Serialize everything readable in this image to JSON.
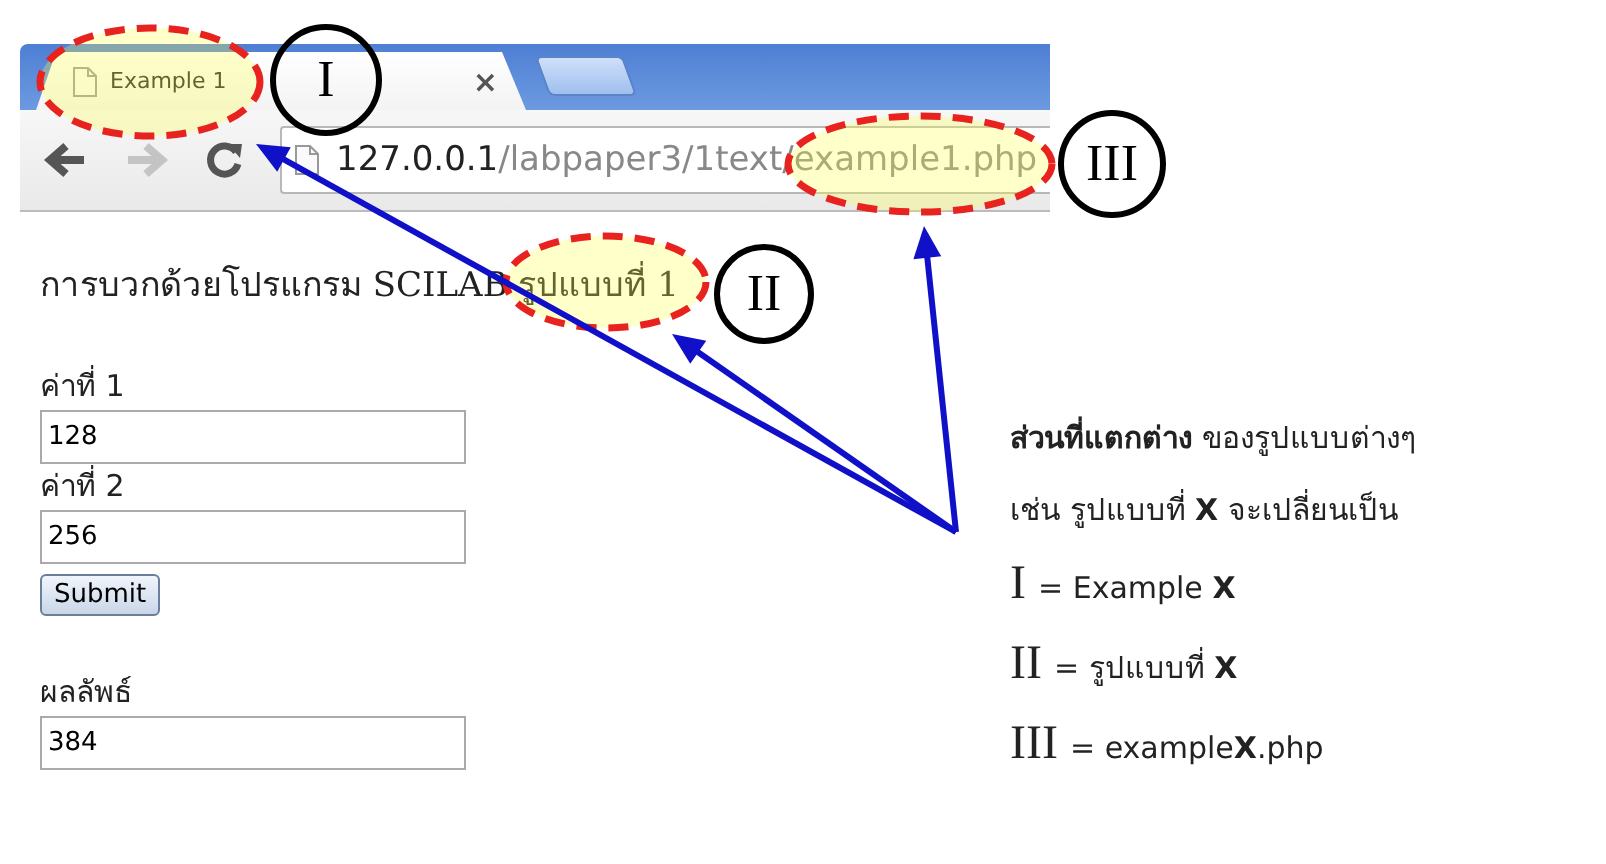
{
  "browser": {
    "tabs": [
      {
        "title": "Example 1",
        "close": "×",
        "selected": true
      }
    ],
    "nav": [
      {
        "kind": "back",
        "disabled": false
      },
      {
        "kind": "forward",
        "disabled": true
      },
      {
        "kind": "reload",
        "disabled": false
      }
    ],
    "address": {
      "host": "127.0.0.1",
      "path": "/labpaper3/1text/example1.php"
    }
  },
  "page": {
    "heading": "การบวกด้วยโปรแกรม SCILAB รูปแบบที่ 1",
    "fields": [
      {
        "label": "ค่าที่ 1",
        "value": "128"
      },
      {
        "label": "ค่าที่ 2",
        "value": "256"
      }
    ],
    "submit": "Submit",
    "result": {
      "label": "ผลลัพธ์",
      "value": "384"
    }
  },
  "annotations": [
    {
      "label": "I"
    },
    {
      "label": "II"
    },
    {
      "label": "III"
    }
  ],
  "legend": {
    "lines": [
      "**ส่วนที่แตกต่าง** ของรูปแบบต่างๆ",
      "เช่น รูปแบบที่ **X** จะเปลี่ยนเป็น"
    ],
    "items": [
      {
        "numeral": "I",
        "text": "= Example **X**"
      },
      {
        "numeral": "II",
        "text": "= รูปแบบที่ **X**"
      },
      {
        "numeral": "III",
        "text": "= example**X**.php"
      }
    ]
  }
}
